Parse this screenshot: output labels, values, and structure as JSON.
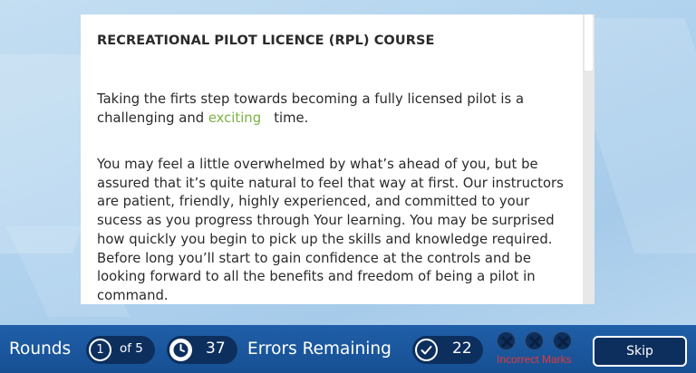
{
  "course": {
    "title": "RECREATIONAL PILOT LICENCE (RPL) COURSE",
    "paragraph1_before": "Taking the firts step towards becoming a fully licensed pilot is a challenging and ",
    "paragraph1_highlight": "exciting",
    "paragraph1_after": "   time.",
    "paragraph2": "You may feel a little overwhelmed by what’s ahead of you, but be assured that it’s quite natural to feel that way at first. Our instructors are patient, friendly, highly experienced, and committed to your sucess as you progress through Your learning. You may be surprised how quickly you begin to pick up the skills and knowledge required. Before long you’ll start to gain confidence at the controls and be looking forward to all the benefits and freedom of being a pilot in command."
  },
  "status_bar": {
    "rounds_label": "Rounds",
    "current_round": "1",
    "rounds_total": "of 5",
    "timer_value": "37",
    "errors_label": "Errors Remaining",
    "errors_value": "22",
    "incorrect_marks_label": "Incorrect Marks",
    "skip_label": "Skip"
  },
  "colors": {
    "highlight": "#7cb342",
    "bar_bg": "#1f5fa8",
    "pill_bg": "#0d2f5e",
    "incorrect": "#e53935"
  },
  "icons": [
    "clock-icon",
    "checkmark-icon",
    "x-mark-icon"
  ]
}
